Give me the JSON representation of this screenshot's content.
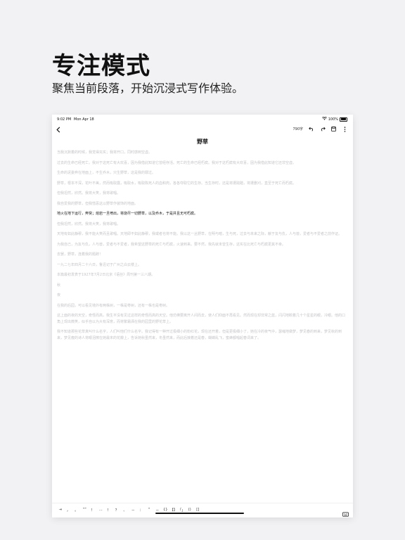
{
  "hero": {
    "title": "专注模式",
    "subtitle": "聚焦当前段落，开始沉浸式写作体验。"
  },
  "status_bar": {
    "time": "9:02 PM",
    "date": "Mon Apr 18",
    "battery": "100%"
  },
  "toolbar": {
    "word_count": "790字",
    "icons": [
      "chevron-left-icon",
      "undo-icon",
      "redo-icon",
      "save-icon",
      "more-icon"
    ]
  },
  "document": {
    "title": "野草",
    "paragraphs": [
      "当我沉默着的时候，我觉得充实；我将开口，同时感到空虚。",
      "过去的生命已经死亡。我对于这死亡有大欢喜，因为我借此知道它曾经存活。死亡的生命已经朽腐。我对于这朽腐有大欢喜，因为我借此知道它还非空虚。",
      "生命的泥委弃在地面上，不生乔木，只生野草，这是我的罪过。",
      "野草，根本不深，花叶不美，然而吸取露，吸取水，吸取陈死人的血和肉，各各夺取它的生存。当生存时，还是将遭践踏，将遭删刈，直至于死亡而朽腐。",
      "但我坦然，欣然。我将大笑，我将歌唱。",
      "我自爱我的野草，但我憎恶这以野草作装饰的地面。",
      "地火在地下运行，奔突；熔岩一旦喷出，将烧尽一切野草，以及乔木，于是并且无可朽腐。",
      "但我坦然，欣然。我将大笑，我将歌唱。",
      "天地有如此静穆，我不能大笑而且歌唱。天地即不如此静穆，我或者也将不能。我以这一丛野草，在明与暗，生与死，过去与未来之际，献于友与仇，人与兽，爱者与不爱者之前作证。",
      "为我自己，为友与仇，人与兽，爱者与不爱者，我希望这野草的死亡与朽腐，火速到来。要不然，我先就未曾生存，这实在比死亡与朽腐更其不幸。",
      "去罢，野草，连着我的题辞！",
      "一九二七年四月二十六日，鲁迅记于广州之白云楼上。",
      "本篇最初发表于1927年7月2日北京《语丝》周刊第一三八期。",
      "秋",
      "夜",
      "在我的后园，可以看见墙外有两株树，一株是枣树，还有一株也是枣树。",
      "这上面的夜的天空，奇怪而高，我生平没有见过这样的奇怪而高的天空。他仿佛要离开人间而去，使人们仰面不再看见。然而现在却非常之蓝，闪闪地睒着几十个星星的眼，冷眼。他的口角上现出微笑，似乎自以为大有深意，而将繁霜洒在我的园里的野花草上。",
      "我不知道那些花草真叫什么名字，人们叫他们什么名字。我记得有一种开过极细小的粉红花，现在还开着，但是更极细小了，她在冷的夜气中，瑟缩地做梦，梦见春的到来，梦见秋的到来，梦见瘦的诗人将眼泪擦在她最末的花瓣上，告诉她秋虽然来，冬虽然来，而此后接着还是春，蝴蝶乱飞，蜜蜂都唱起春词来了。"
    ],
    "active_index": 6
  },
  "bottom_bar": {
    "keys": [
      "⇥",
      "，",
      "。",
      "“”",
      "！",
      "…",
      "！",
      "？",
      "、",
      "－",
      "：",
      "\"",
      "－",
      "{}",
      "【】",
      "「」",
      "()",
      "[]"
    ]
  }
}
